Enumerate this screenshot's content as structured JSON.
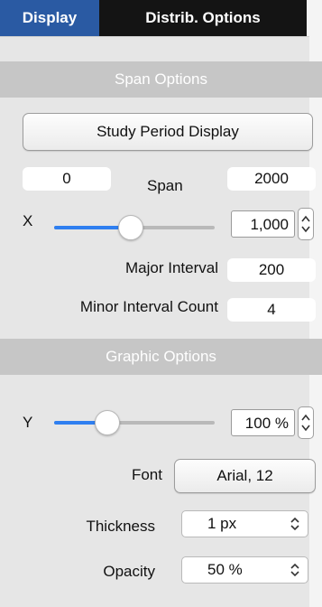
{
  "tabs": {
    "display": "Display",
    "distrib": "Distrib. Options"
  },
  "span_options": {
    "header": "Span Options",
    "study_button": "Study Period Display",
    "start_value": "0",
    "span_label": "Span",
    "end_value": "2000",
    "x_label": "X",
    "x_slider_fraction": 0.48,
    "x_value": "1,000",
    "major_interval_label": "Major Interval",
    "major_interval_value": "200",
    "minor_count_label": "Minor Interval Count",
    "minor_count_value": "4"
  },
  "graphic_options": {
    "header": "Graphic Options",
    "y_label": "Y",
    "y_slider_fraction": 0.33,
    "y_value": "100 %",
    "font_label": "Font",
    "font_button": "Arial, 12",
    "thickness_label": "Thickness",
    "thickness_value": "1 px",
    "opacity_label": "Opacity",
    "opacity_value": "50 %"
  },
  "colors": {
    "accent": "#2a5aa3",
    "slider_fill": "#2f7ff0",
    "header_bg": "#c6c6c6"
  },
  "icons": {
    "stepper": "up-down-arrows-icon",
    "select": "up-down-chevron-icon"
  }
}
